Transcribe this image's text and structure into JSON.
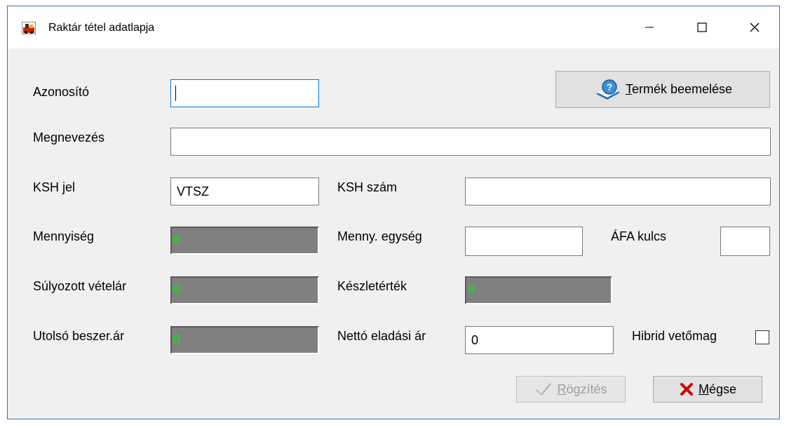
{
  "window": {
    "title": "Raktár tétel adatlapja",
    "controls": {
      "minimize": "—",
      "maximize": "☐",
      "close": "✕"
    }
  },
  "fields": {
    "azonosito": {
      "label": "Azonosító",
      "value": ""
    },
    "megnevezes": {
      "label": "Megnevezés",
      "value": ""
    },
    "ksh_jel": {
      "label": "KSH jel",
      "value": "VTSZ"
    },
    "ksh_szam": {
      "label": "KSH szám",
      "value": ""
    },
    "mennyiseg": {
      "label": "Mennyiség",
      "value": "0"
    },
    "menny_egyseg": {
      "label": "Menny. egység",
      "value": ""
    },
    "afa_kulcs": {
      "label": "ÁFA kulcs",
      "value": ""
    },
    "sulyozott_vetelar": {
      "label": "Súlyozott vételár",
      "value": "0"
    },
    "keszletertek": {
      "label": "Készletérték",
      "value": "0"
    },
    "utolso_beszer_ar": {
      "label": "Utolsó beszer.ár",
      "value": "0"
    },
    "netto_eladasi_ar": {
      "label": "Nettó eladási ár",
      "value": "0"
    },
    "hibrid_vetomag": {
      "label": "Hibrid vetőmag",
      "checked": false
    }
  },
  "buttons": {
    "termek_beemelese": {
      "accel": "T",
      "rest": "ermék beemelése",
      "icon": "help-book-icon"
    },
    "rogzites": {
      "accel": "R",
      "rest": "ögzítés",
      "icon": "checkmark-icon",
      "enabled": false
    },
    "megse": {
      "accel": "M",
      "rest": "égse",
      "icon": "red-x-icon"
    }
  },
  "colors": {
    "accent_border": "#0078d7",
    "numeric_display_bg": "#808080",
    "numeric_display_text": "#00ee00",
    "cancel_icon": "#cc0000"
  }
}
